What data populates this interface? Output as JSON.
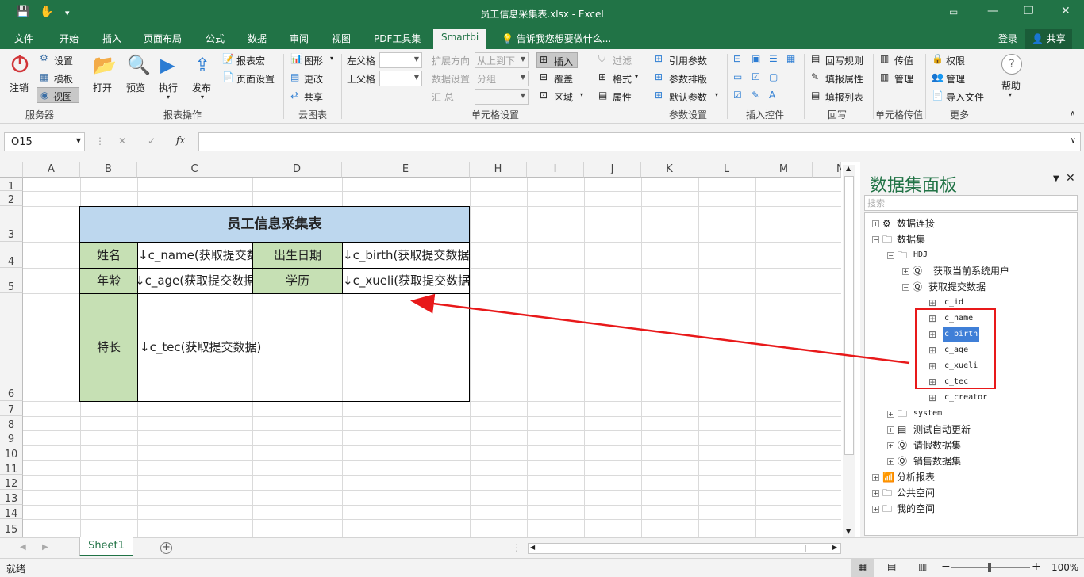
{
  "window": {
    "title": "员工信息采集表.xlsx - Excel",
    "minimize": "—",
    "restore": "❐",
    "close": "✕"
  },
  "menu": {
    "tabs": [
      "文件",
      "开始",
      "插入",
      "页面布局",
      "公式",
      "数据",
      "审阅",
      "视图",
      "PDF工具集",
      "Smartbi"
    ],
    "tell_me": "告诉我您想要做什么...",
    "login": "登录",
    "share": "共享"
  },
  "ribbon": {
    "logout": "注销",
    "settings": "设置",
    "template": "模板",
    "view": "视图",
    "group_server": "服务器",
    "open": "打开",
    "preview": "预览",
    "execute": "执行",
    "publish": "发布",
    "report_macro": "报表宏",
    "page_setup": "页面设置",
    "group_report_ops": "报表操作",
    "chart": "图形",
    "change": "更改",
    "share": "共享",
    "group_cloud_chart": "云图表",
    "left_parent": "左父格",
    "top_parent": "上父格",
    "expand_dir": "扩展方向",
    "expand_value": "从上到下",
    "data_settings": "数据设置",
    "data_value": "分组",
    "summary": "汇    总",
    "insert": "插入",
    "overwrite": "覆盖",
    "region": "区域",
    "filter": "过滤",
    "format": "格式",
    "property": "属性",
    "group_cell_settings": "单元格设置",
    "ref_param": "引用参数",
    "param_layout": "参数排版",
    "default_param": "默认参数",
    "group_param_settings": "参数设置",
    "group_insert_control": "插入控件",
    "writeback_rule": "回写规则",
    "fill_property": "填报属性",
    "fill_list": "填报列表",
    "group_writeback": "回写",
    "pass_value": "传值",
    "manage": "管理",
    "group_cell_pass": "单元格传值",
    "permission": "权限",
    "manage2": "管理",
    "import_file": "导入文件",
    "group_more": "更多",
    "help": "帮助"
  },
  "formula_bar": {
    "name_box": "O15",
    "cancel": "✕",
    "enter": "✓",
    "fx": "fx",
    "value": ""
  },
  "sheet": {
    "columns": [
      "A",
      "B",
      "C",
      "D",
      "E",
      "H",
      "I",
      "J",
      "K",
      "L",
      "M",
      "N"
    ],
    "rows": [
      "1",
      "2",
      "3",
      "4",
      "5",
      "6",
      "7",
      "8",
      "9",
      "10",
      "11",
      "12",
      "13",
      "14",
      "15"
    ],
    "table_title": "员工信息采集表",
    "label_name": "姓名",
    "value_name": "↓c_name(获取提交数据)",
    "label_birth": "出生日期",
    "value_birth": "↓c_birth(获取提交数据)",
    "label_age": "年龄",
    "value_age": "↓c_age(获取提交数据)",
    "label_edu": "学历",
    "value_edu": "↓c_xueli(获取提交数据)",
    "label_skill": "特长",
    "value_skill": "↓c_tec(获取提交数据)",
    "header_fill": "#bdd7ee",
    "label_fill": "#c6e0b4"
  },
  "panel": {
    "title": "数据集面板",
    "search_placeholder": "搜索",
    "tree": {
      "data_connection": "数据连接",
      "dataset": "数据集",
      "hdj": "HDJ",
      "current_user": "获取当前系统用户",
      "submit_data": "获取提交数据",
      "fields": [
        "c_id",
        "c_name",
        "c_birth",
        "c_age",
        "c_xueli",
        "c_tec",
        "c_creator"
      ],
      "system": "system",
      "auto_refresh": "测试自动更新",
      "leave_data": "请假数据集",
      "sales_data": "销售数据集",
      "analysis_report": "分析报表",
      "public_space": "公共空间",
      "my_space": "我的空间"
    }
  },
  "sheet_tabs": {
    "active": "Sheet1",
    "add": "+"
  },
  "status": {
    "ready": "就绪",
    "zoom": "100%",
    "minus": "−",
    "plus": "+"
  },
  "colors": {
    "excel_green": "#217346",
    "annotation_red": "#e8191a",
    "selection_blue": "#3f7fd7"
  }
}
